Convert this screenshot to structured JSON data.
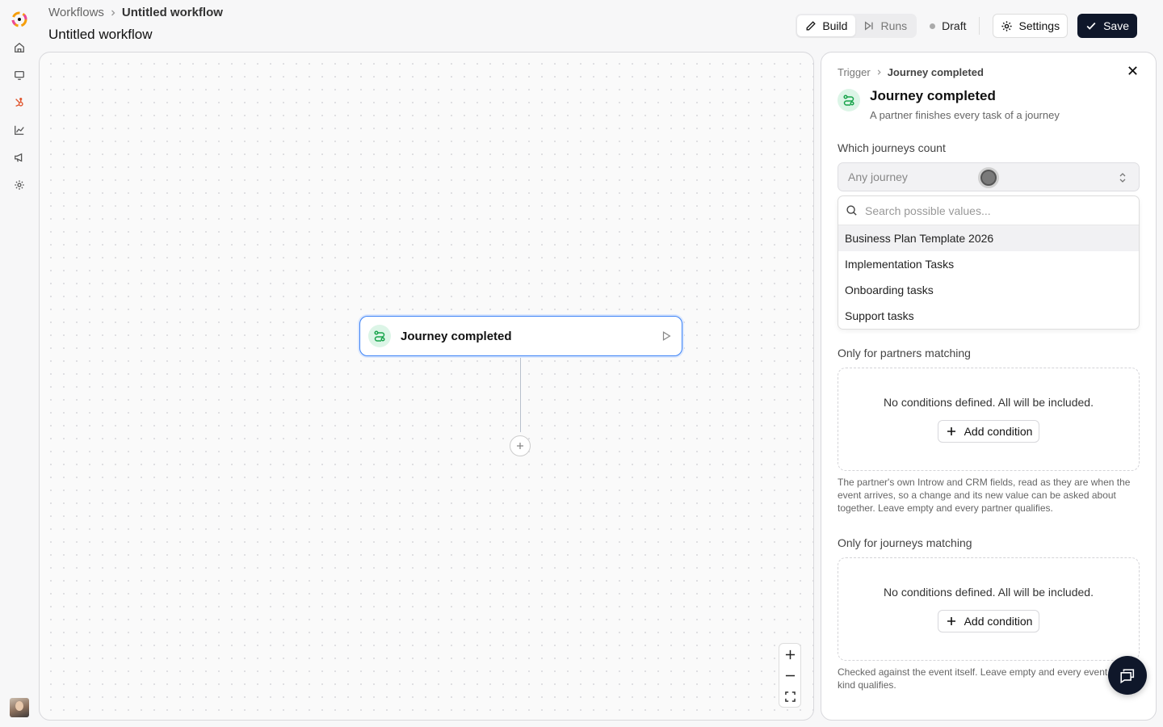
{
  "header": {
    "breadcrumb": {
      "root": "Workflows",
      "current": "Untitled workflow"
    },
    "title": "Untitled workflow",
    "tabs": [
      {
        "label": "Build",
        "active": true
      },
      {
        "label": "Runs",
        "active": false
      }
    ],
    "status": "Draft",
    "settings_label": "Settings",
    "save_label": "Save"
  },
  "rail": {
    "items": [
      "home-icon",
      "monitor-icon",
      "hubspot-icon",
      "chart-icon",
      "megaphone-icon",
      "gear-icon"
    ],
    "active": "hubspot-icon"
  },
  "canvas": {
    "node": {
      "label": "Journey completed",
      "icon": "trigger-icon"
    },
    "zoom": [
      "zoom-in-icon",
      "zoom-out-icon",
      "fit-view-icon"
    ]
  },
  "panel": {
    "breadcrumb": {
      "root": "Trigger",
      "current": "Journey completed"
    },
    "title": "Journey completed",
    "description": "A partner finishes every task of a journey",
    "journeys": {
      "label": "Which journeys count",
      "placeholder": "Any journey",
      "search_placeholder": "Search possible values...",
      "options": [
        "Business Plan Template 2026",
        "Implementation Tasks",
        "Onboarding tasks",
        "Support tasks"
      ],
      "highlighted": "Business Plan Template 2026"
    },
    "partners": {
      "label": "Only for partners matching",
      "empty_text": "No conditions defined. All will be included.",
      "add_label": "Add condition",
      "help": "The partner's own Introw and CRM fields, read as they are when the event arrives, so a change and its new value can be asked about together. Leave empty and every partner qualifies."
    },
    "journey_match": {
      "label": "Only for journeys matching",
      "empty_text": "No conditions defined. All will be included.",
      "add_label": "Add condition",
      "help": "Checked against the event itself. Leave empty and every event of this kind qualifies."
    }
  },
  "colors": {
    "accent": "#3b82f6",
    "primary_button": "#0f172a",
    "trigger_green": "#16a34a",
    "rail_active": "#e0562f"
  }
}
